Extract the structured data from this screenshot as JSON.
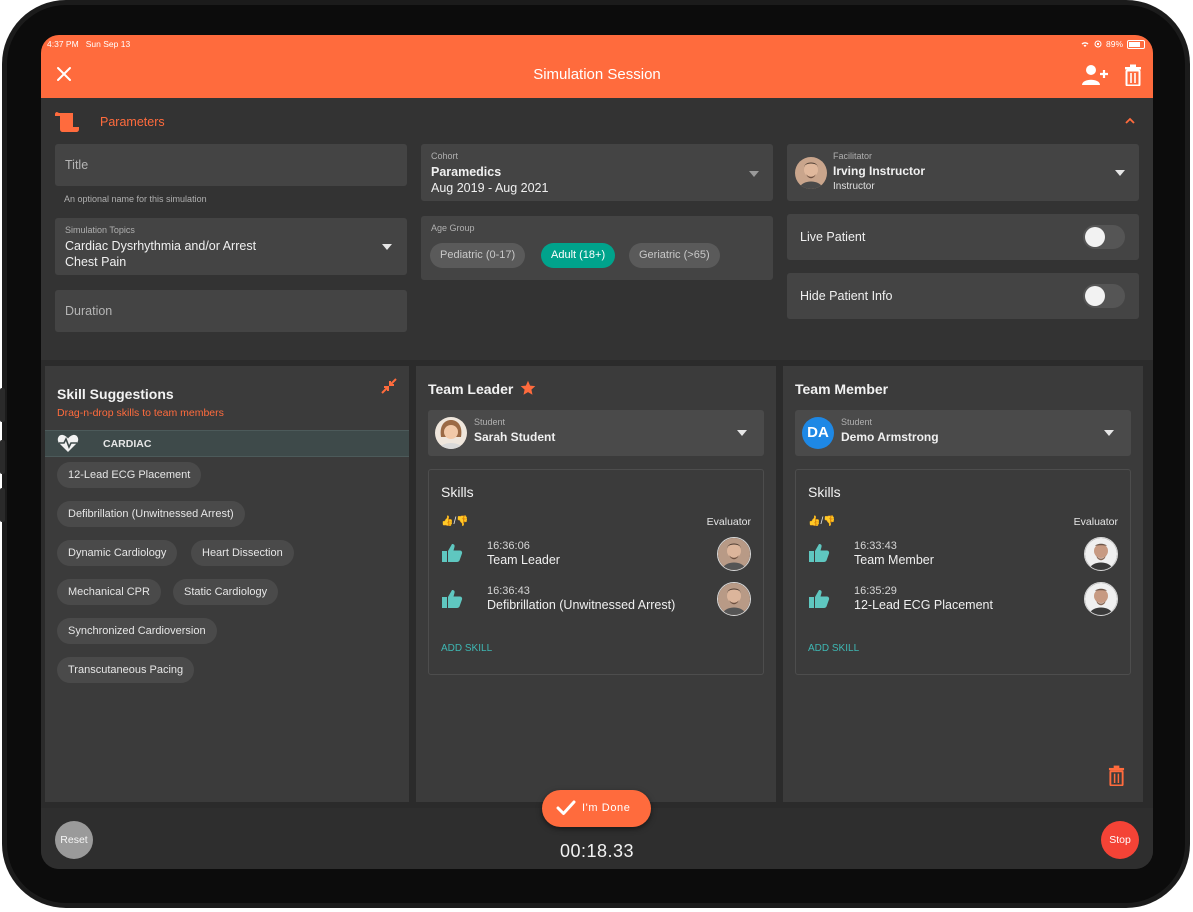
{
  "status_bar": {
    "time": "4:37 PM",
    "date": "Sun Sep 13",
    "battery": "89%"
  },
  "header": {
    "title": "Simulation Session"
  },
  "parameters": {
    "label": "Parameters",
    "title_field": {
      "placeholder": "Title",
      "helper": "An optional name for this simulation"
    },
    "topics": {
      "caption": "Simulation Topics",
      "lines": [
        "Cardiac Dysrhythmia and/or Arrest",
        "Chest Pain"
      ]
    },
    "duration": {
      "placeholder": "Duration"
    },
    "cohort": {
      "caption": "Cohort",
      "name": "Paramedics",
      "range": "Aug 2019 - Aug 2021"
    },
    "age_group": {
      "caption": "Age Group",
      "options": [
        "Pediatric (0-17)",
        "Adult (18+)",
        "Geriatric (>65)"
      ],
      "selected": "Adult (18+)"
    },
    "facilitator": {
      "caption": "Facilitator",
      "name": "Irving Instructor",
      "role": "Instructor"
    },
    "live_patient": {
      "label": "Live Patient",
      "on": false
    },
    "hide_patient_info": {
      "label": "Hide Patient Info",
      "on": false
    }
  },
  "skill_suggestions": {
    "title": "Skill Suggestions",
    "hint": "Drag-n-drop skills to team members",
    "category": "CARDIAC",
    "skills": [
      "12-Lead ECG Placement",
      "Defibrillation (Unwitnessed Arrest)",
      "Dynamic Cardiology",
      "Heart Dissection",
      "Mechanical CPR",
      "Static Cardiology",
      "Synchronized Cardioversion",
      "Transcutaneous Pacing"
    ]
  },
  "team_leader": {
    "title": "Team Leader",
    "student": {
      "caption": "Student",
      "name": "Sarah Student"
    },
    "skills_title": "Skills",
    "thumbs_header": "👍/👎",
    "evaluator_header": "Evaluator",
    "skills": [
      {
        "time": "16:36:06",
        "name": "Team Leader"
      },
      {
        "time": "16:36:43",
        "name": "Defibrillation (Unwitnessed Arrest)"
      }
    ],
    "add_skill": "ADD SKILL"
  },
  "team_member": {
    "title": "Team Member",
    "student": {
      "caption": "Student",
      "name": "Demo Armstrong",
      "initials": "DA"
    },
    "skills_title": "Skills",
    "thumbs_header": "👍/👎",
    "evaluator_header": "Evaluator",
    "skills": [
      {
        "time": "16:33:43",
        "name": "Team Member"
      },
      {
        "time": "16:35:29",
        "name": "12-Lead ECG Placement"
      }
    ],
    "add_skill": "ADD SKILL"
  },
  "footer": {
    "reset_label": "Reset",
    "done_label": "I'm Done",
    "timer": "00:18.33",
    "stop_label": "Stop"
  },
  "colors": {
    "accent": "#ff6b3d",
    "teal": "#00a38c",
    "stop": "#f44336",
    "link": "#3eb7b3"
  }
}
